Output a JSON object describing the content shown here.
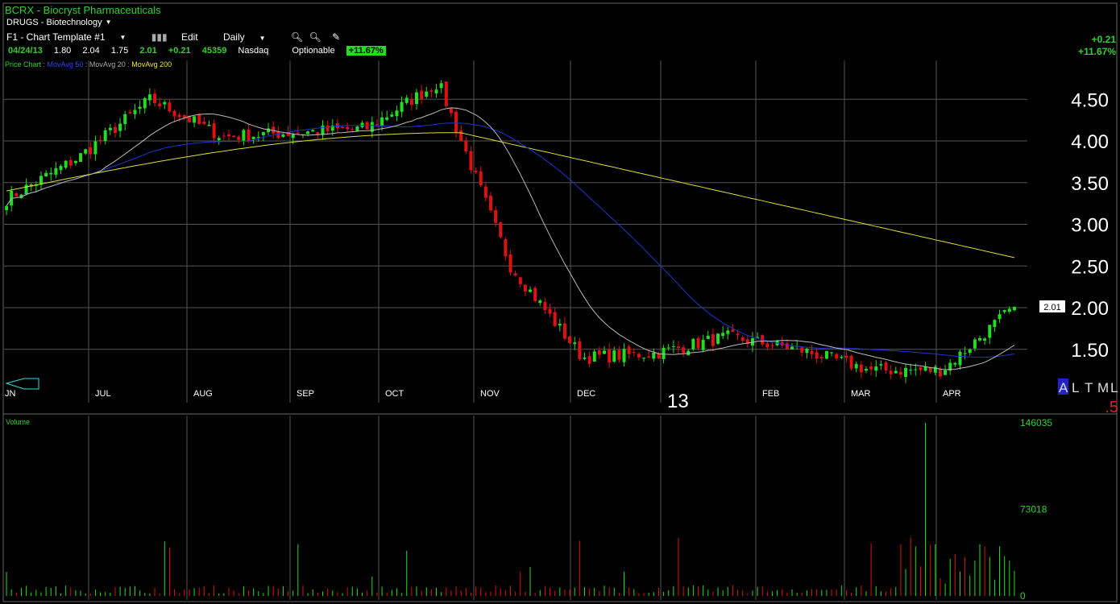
{
  "header": {
    "ticker": "BCRX - Biocryst Pharmaceuticals",
    "sector": "DRUGS - Biotechnology",
    "template": "F1 - Chart Template #1",
    "edit_label": "Edit",
    "period": "Daily",
    "quote": {
      "date": "04/24/13",
      "open": "1.80",
      "high": "2.04",
      "low": "1.75",
      "close": "2.01",
      "change": "+0.21",
      "volume": "45359",
      "exchange": "Nasdaq",
      "optionable": "Optionable",
      "pct_change": "+11.67%"
    },
    "legend": {
      "price": "Price Chart",
      "ma50": "MovAvg 50",
      "ma20": "MovAvg 20",
      "ma200": "MovAvg 200"
    },
    "right_change": "+0.21",
    "right_pct": "+11.67%"
  },
  "colors": {
    "up": "#22dd22",
    "down": "#dd1111",
    "ma50": "#2233cc",
    "ma20": "#bbbbbb",
    "ma200": "#dddd33",
    "grid": "#555555"
  },
  "chart_data": {
    "type": "candlestick",
    "price_ticks": [
      "4.50",
      "4.00",
      "3.50",
      "3.00",
      "2.50",
      "2.00",
      "1.50"
    ],
    "months": [
      "JN",
      "JUL",
      "AUG",
      "SEP",
      "OCT",
      "NOV",
      "DEC",
      "13",
      "FEB",
      "MAR",
      "APR"
    ],
    "year_label": "13",
    "last_price_label": "2.01",
    "timeframe_labels": [
      "A",
      "L",
      "T",
      "M",
      "L"
    ],
    "bottom_right_label": ".5",
    "volume_label": "Volume",
    "volume_ticks": [
      "146035",
      "73018",
      "0"
    ],
    "price_series": [
      {
        "label": "JN",
        "close": 3.3
      },
      {
        "label": "JUL",
        "close": 3.8
      },
      {
        "label": "JUL",
        "close": 4.5
      },
      {
        "label": "AUG",
        "close": 4.05
      },
      {
        "label": "SEP",
        "close": 4.1
      },
      {
        "label": "OCT",
        "close": 4.15
      },
      {
        "label": "OCT",
        "close": 4.7
      },
      {
        "label": "NOV",
        "close": 2.5
      },
      {
        "label": "NOV",
        "close": 1.4
      },
      {
        "label": "DEC",
        "close": 1.45
      },
      {
        "label": "13",
        "close": 1.65
      },
      {
        "label": "FEB",
        "close": 1.5
      },
      {
        "label": "MAR",
        "close": 1.25
      },
      {
        "label": "APR",
        "close": 1.25
      },
      {
        "label": "APR",
        "close": 2.01
      }
    ],
    "ma200_end": 2.6,
    "ma50_end": 1.4,
    "ma20_end": 1.65
  }
}
